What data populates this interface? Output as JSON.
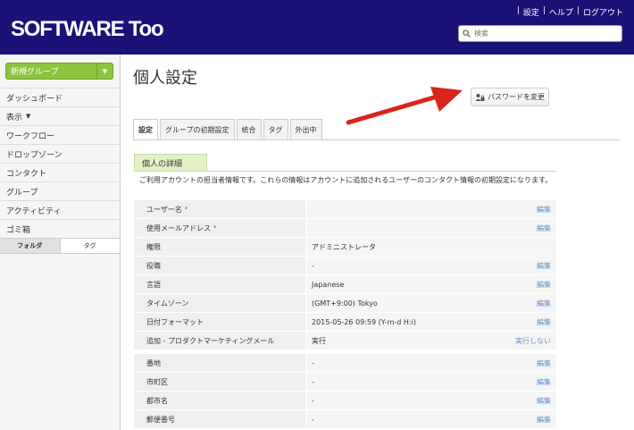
{
  "app": {
    "logo": "SOFTWARE Too"
  },
  "header": {
    "links": [
      "|",
      "設定",
      "|",
      "ヘルプ",
      "|",
      "ログアウト"
    ],
    "search_placeholder": "検索"
  },
  "sidebar": {
    "new_group_label": "新規グループ",
    "items": [
      {
        "label": "ダッシュボード"
      },
      {
        "label": "表示"
      },
      {
        "label": "ワークフロー"
      },
      {
        "label": "ドロップゾーン"
      },
      {
        "label": "コンタクト"
      },
      {
        "label": "グループ"
      },
      {
        "label": "アクティビティ"
      },
      {
        "label": "ゴミ箱"
      }
    ],
    "tabs": [
      "フォルダ",
      "タグ"
    ]
  },
  "main": {
    "title": "個人設定",
    "password_button": "パスワードを変更",
    "tabs": [
      "設定",
      "グループの初期設定",
      "統合",
      "タグ",
      "外出中"
    ],
    "section_title": "個人の詳細",
    "description": "ご利用アカウントの担当者情報です。これらの情報はアカウントに追加されるユーザーのコンタクト情報の初期設定になります。",
    "rows": [
      {
        "label": "ユーザー名",
        "value": "",
        "action": "編集"
      },
      {
        "label": "使用メールアドレス",
        "value": "",
        "action": "編集"
      },
      {
        "label": "権限",
        "value": "アドミニストレータ",
        "action": ""
      },
      {
        "label": "役職",
        "value": "-",
        "action": "編集"
      },
      {
        "label": "言語",
        "value": "Japanese",
        "action": "編集"
      },
      {
        "label": "タイムゾーン",
        "value": "(GMT+9:00) Tokyo",
        "action": "編集"
      },
      {
        "label": "日付フォーマット",
        "value": "2015-05-26 09:59 (Y-m-d H:i)",
        "action": "編集"
      },
      {
        "label": "追加 - プロダクトマーケティングメール",
        "value": "実行",
        "action": "実行しない"
      },
      {
        "label": "番地",
        "value": "-",
        "action": "編集"
      },
      {
        "label": "市町区",
        "value": "-",
        "action": "編集"
      },
      {
        "label": "都市名",
        "value": "-",
        "action": "編集"
      },
      {
        "label": "郵便番号",
        "value": "-",
        "action": "編集"
      }
    ]
  },
  "colors": {
    "header": "#1b1278",
    "accent_green": "#8bc53f",
    "arrow": "#d9261c",
    "link": "#5b8fc7"
  }
}
